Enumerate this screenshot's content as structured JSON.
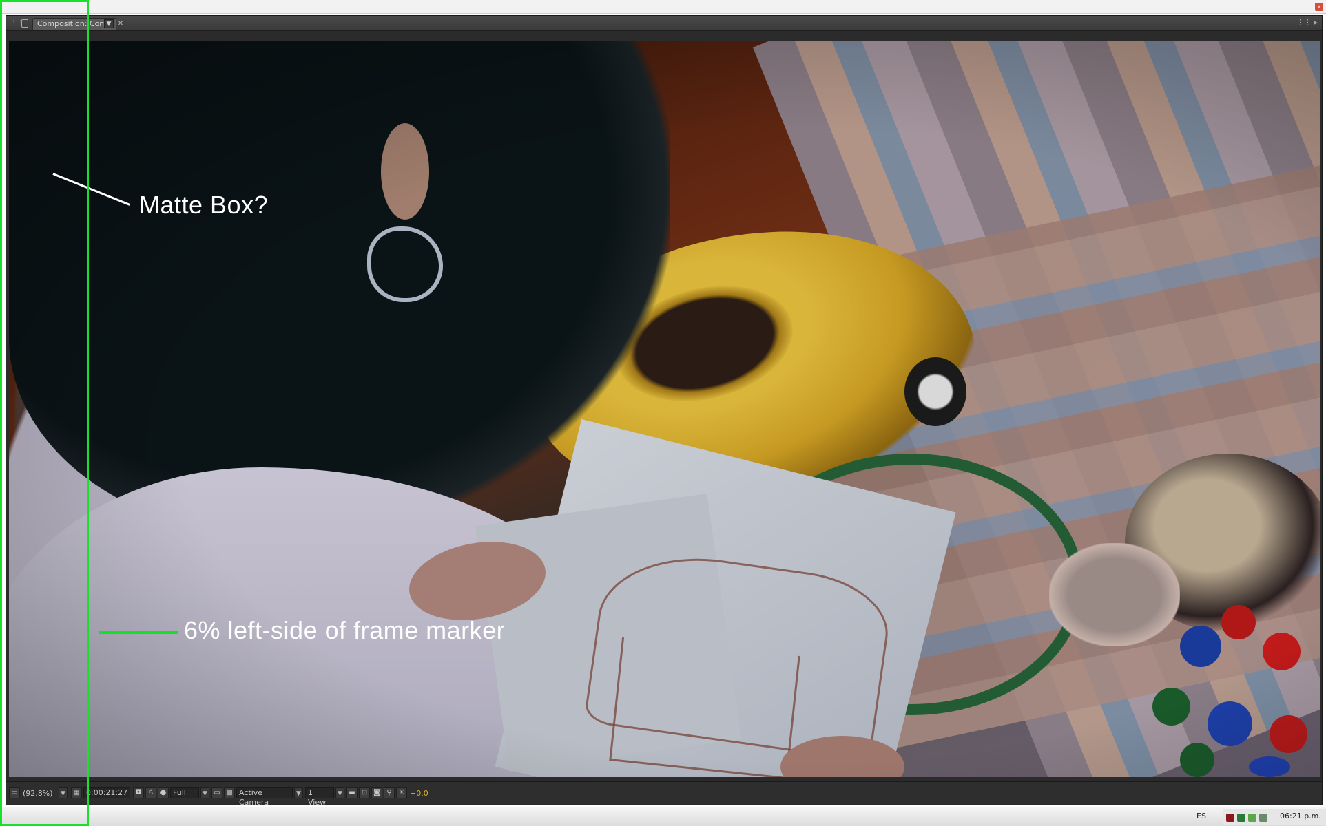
{
  "window": {
    "panel_tab_label": "Composition: Comp",
    "close_glyph": "x"
  },
  "icons": {
    "panel_grip": "grip-icon",
    "lock": "lock-icon",
    "dropdown": "chevron-down-icon",
    "close": "close-icon",
    "panel_menu": "panel-menu-icon"
  },
  "annotations": {
    "matte_box": "Matte Box?",
    "frame_marker": "6% left-side of frame marker"
  },
  "status_bar": {
    "zoom": "(92.8%)",
    "timecode": "0:00:21:27",
    "resolution": "Full",
    "camera": "Active Camera",
    "view_layout": "1 View",
    "exposure": "+0.0"
  },
  "taskbar": {
    "language": "ES",
    "clock": "06:21 p.m."
  },
  "colors": {
    "guide_green": "#19e02a",
    "panel_bg": "#2b2b2b",
    "exposure": "#e0b020"
  }
}
